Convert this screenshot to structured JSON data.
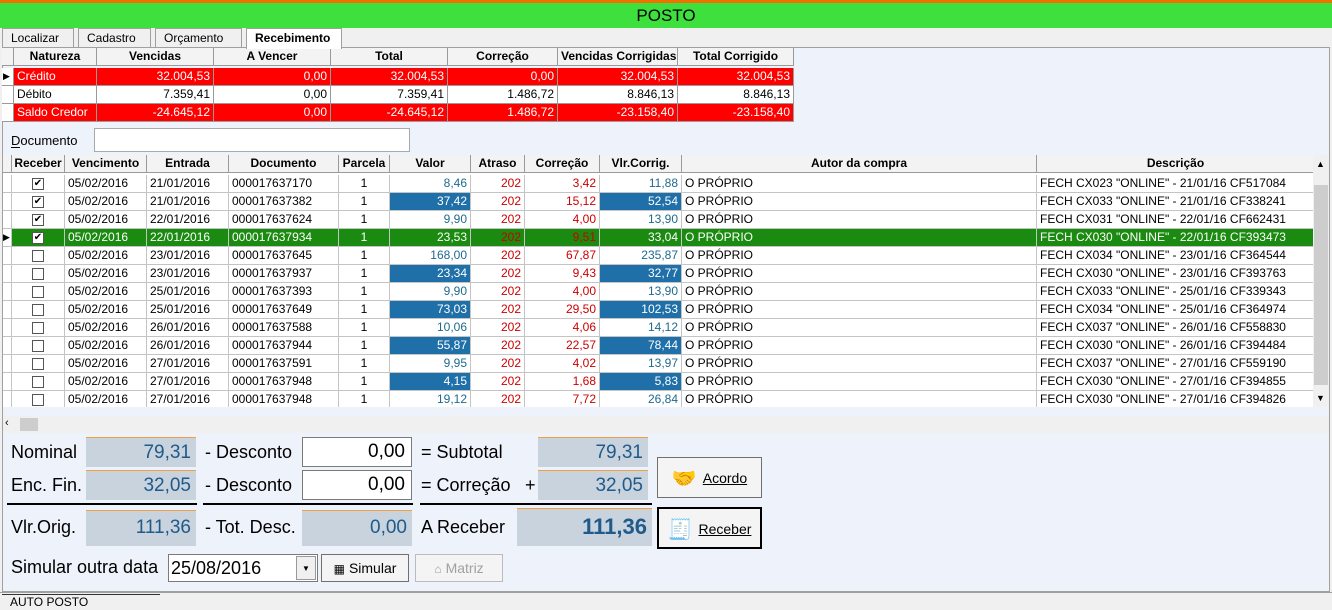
{
  "title": "POSTO",
  "tabs": [
    "Localizar",
    "Cadastro",
    "Orçamento",
    "Recebimento"
  ],
  "summary": {
    "headers": [
      "Natureza",
      "Vencidas",
      "A Vencer",
      "Total",
      "Correção",
      "Vencidas Corrigidas",
      "Total Corrigido"
    ],
    "rows": [
      [
        "Crédito",
        "32.004,53",
        "0,00",
        "32.004,53",
        "0,00",
        "32.004,53",
        "32.004,53"
      ],
      [
        "Débito",
        "7.359,41",
        "0,00",
        "7.359,41",
        "1.486,72",
        "8.846,13",
        "8.846,13"
      ],
      [
        "Saldo Credor",
        "-24.645,12",
        "0,00",
        "-24.645,12",
        "1.486,72",
        "-23.158,40",
        "-23.158,40"
      ]
    ]
  },
  "documento_label": "Documento",
  "documento_value": "",
  "grid": {
    "headers": [
      "Receber",
      "Vencimento",
      "Entrada",
      "Documento",
      "Parcela",
      "Valor",
      "Atraso",
      "Correção",
      "Vlr.Corrig.",
      "Autor da compra",
      "Descrição"
    ],
    "rows": [
      {
        "checked": true,
        "v": [
          "05/02/2016",
          "21/01/2016",
          "000017637170",
          "1",
          "8,46",
          "202",
          "3,42",
          "11,88",
          "O PRÓPRIO",
          "FECH CX023 \"ONLINE\" - 21/01/16 CF517084"
        ]
      },
      {
        "checked": true,
        "v": [
          "05/02/2016",
          "21/01/2016",
          "000017637382",
          "1",
          "37,42",
          "202",
          "15,12",
          "52,54",
          "O PRÓPRIO",
          "FECH CX033 \"ONLINE\" - 21/01/16 CF338241"
        ]
      },
      {
        "checked": true,
        "v": [
          "05/02/2016",
          "22/01/2016",
          "000017637624",
          "1",
          "9,90",
          "202",
          "4,00",
          "13,90",
          "O PRÓPRIO",
          "FECH CX031 \"ONLINE\" - 22/01/16 CF662431"
        ]
      },
      {
        "checked": true,
        "v": [
          "05/02/2016",
          "22/01/2016",
          "000017637934",
          "1",
          "23,53",
          "202",
          "9,51",
          "33,04",
          "O PRÓPRIO",
          "FECH CX030 \"ONLINE\" - 22/01/16 CF393473"
        ]
      },
      {
        "checked": false,
        "v": [
          "05/02/2016",
          "23/01/2016",
          "000017637645",
          "1",
          "168,00",
          "202",
          "67,87",
          "235,87",
          "O PRÓPRIO",
          "FECH CX034 \"ONLINE\" - 23/01/16 CF364544"
        ]
      },
      {
        "checked": false,
        "v": [
          "05/02/2016",
          "23/01/2016",
          "000017637937",
          "1",
          "23,34",
          "202",
          "9,43",
          "32,77",
          "O PRÓPRIO",
          "FECH CX030 \"ONLINE\" - 23/01/16 CF393763"
        ]
      },
      {
        "checked": false,
        "v": [
          "05/02/2016",
          "25/01/2016",
          "000017637393",
          "1",
          "9,90",
          "202",
          "4,00",
          "13,90",
          "O PRÓPRIO",
          "FECH CX033 \"ONLINE\" - 25/01/16 CF339343"
        ]
      },
      {
        "checked": false,
        "v": [
          "05/02/2016",
          "25/01/2016",
          "000017637649",
          "1",
          "73,03",
          "202",
          "29,50",
          "102,53",
          "O PRÓPRIO",
          "FECH CX034 \"ONLINE\" - 25/01/16 CF364974"
        ]
      },
      {
        "checked": false,
        "v": [
          "05/02/2016",
          "26/01/2016",
          "000017637588",
          "1",
          "10,06",
          "202",
          "4,06",
          "14,12",
          "O PRÓPRIO",
          "FECH CX037 \"ONLINE\" - 26/01/16 CF558830"
        ]
      },
      {
        "checked": false,
        "v": [
          "05/02/2016",
          "26/01/2016",
          "000017637944",
          "1",
          "55,87",
          "202",
          "22,57",
          "78,44",
          "O PRÓPRIO",
          "FECH CX030 \"ONLINE\" - 26/01/16 CF394484"
        ]
      },
      {
        "checked": false,
        "v": [
          "05/02/2016",
          "27/01/2016",
          "000017637591",
          "1",
          "9,95",
          "202",
          "4,02",
          "13,97",
          "O PRÓPRIO",
          "FECH CX037 \"ONLINE\" - 27/01/16 CF559190"
        ]
      },
      {
        "checked": false,
        "v": [
          "05/02/2016",
          "27/01/2016",
          "000017637948",
          "1",
          "4,15",
          "202",
          "1,68",
          "5,83",
          "O PRÓPRIO",
          "FECH CX030 \"ONLINE\" - 27/01/16 CF394855"
        ]
      },
      {
        "checked": false,
        "v": [
          "05/02/2016",
          "27/01/2016",
          "000017637948",
          "1",
          "19,12",
          "202",
          "7,72",
          "26,84",
          "O PRÓPRIO",
          "FECH CX030 \"ONLINE\" - 27/01/16 CF394826"
        ]
      }
    ]
  },
  "totals": {
    "nominal_label": "Nominal",
    "nominal": "79,31",
    "desconto1_label": "- Desconto",
    "desconto1": "0,00",
    "subtotal_label": "= Subtotal",
    "subtotal": "79,31",
    "encfin_label": "Enc. Fin.",
    "encfin": "32,05",
    "desconto2_label": "- Desconto",
    "desconto2": "0,00",
    "correcao_label": "= Correção",
    "plus": "+",
    "correcao": "32,05",
    "vlrorig_label": "Vlr.Orig.",
    "vlrorig": "111,36",
    "totdesc_label": "- Tot. Desc.",
    "totdesc": "0,00",
    "areceber_label": "A Receber",
    "areceber": "111,36"
  },
  "buttons": {
    "acordo": "Acordo",
    "receber": "Receber",
    "simular": "Simular",
    "matriz": "Matriz"
  },
  "simular_label": "Simular outra data",
  "simular_date": "25/08/2016",
  "status_tab": "AUTO POSTO"
}
